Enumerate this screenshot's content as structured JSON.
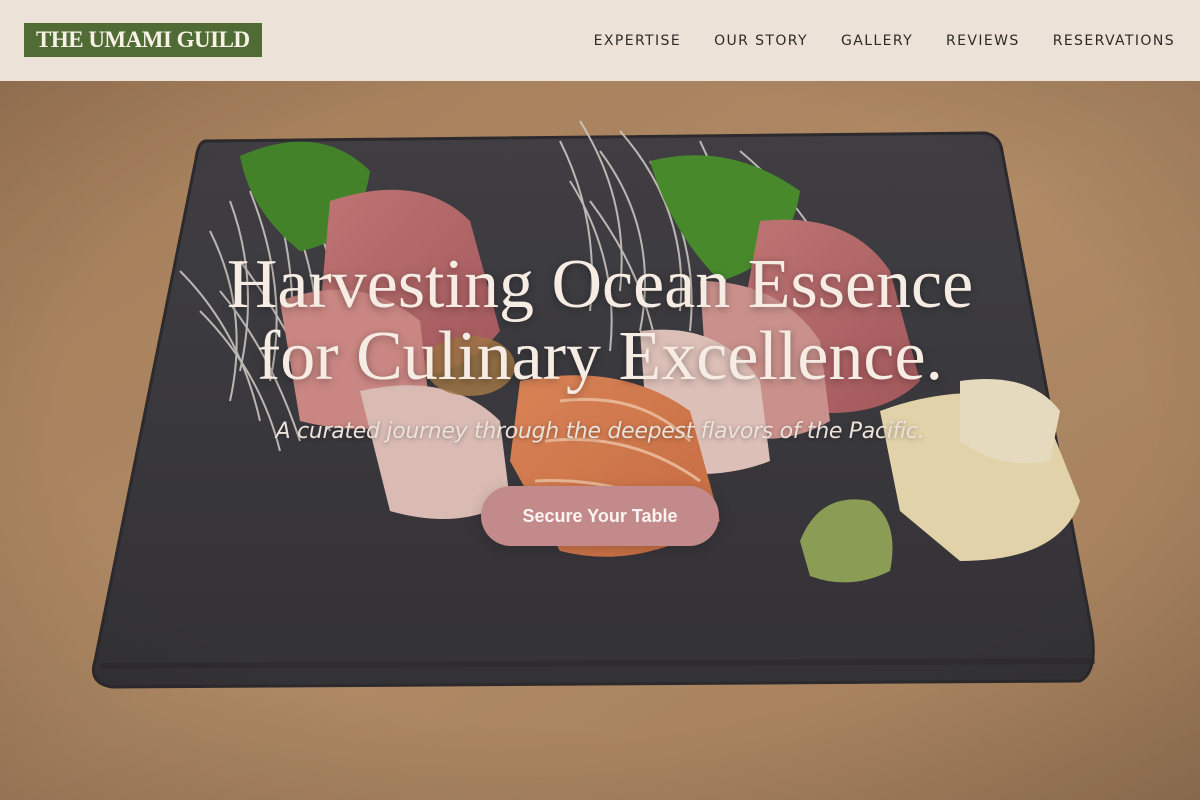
{
  "brand": {
    "name": "THE UMAMI GUILD"
  },
  "nav": {
    "items": [
      {
        "label": "EXPERTISE"
      },
      {
        "label": "OUR STORY"
      },
      {
        "label": "GALLERY"
      },
      {
        "label": "REVIEWS"
      },
      {
        "label": "RESERVATIONS"
      }
    ]
  },
  "hero": {
    "title_line_1": "Harvesting Ocean Essence",
    "title_line_2": "for Culinary Excellence.",
    "subtitle": "A curated journey through the deepest flavors of the Pacific.",
    "cta_label": "Secure Your Table"
  },
  "colors": {
    "header_bg": "#ede2d8",
    "brand_bg": "#516b34",
    "cta_bg": "#c38a8b",
    "hero_text": "#f6ece4"
  }
}
